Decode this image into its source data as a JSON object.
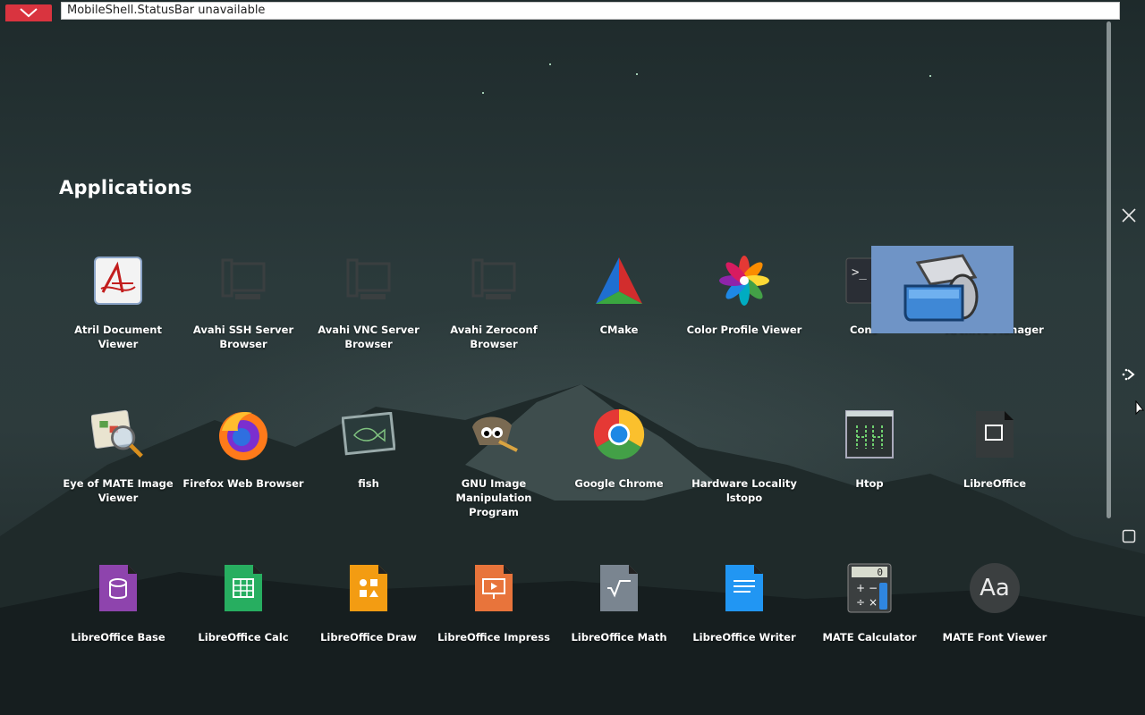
{
  "status_bar": {
    "text": "MobileShell.StatusBar unavailable"
  },
  "section": {
    "title": "Applications"
  },
  "apps": [
    {
      "label": "Atril Document Viewer",
      "icon": "atril-icon"
    },
    {
      "label": "Avahi SSH Server Browser",
      "icon": "avahi-ssh-icon"
    },
    {
      "label": "Avahi VNC Server Browser",
      "icon": "avahi-vnc-icon"
    },
    {
      "label": "Avahi Zeroconf Browser",
      "icon": "avahi-zeroconf-icon"
    },
    {
      "label": "CMake",
      "icon": "cmake-icon"
    },
    {
      "label": "Color Profile Viewer",
      "icon": "color-profile-icon"
    },
    {
      "label": "Cons",
      "icon": "console-icon"
    },
    {
      "label": "Archive Manager",
      "icon": "archive-manager-icon"
    },
    {
      "label": "Eye of MATE Image Viewer",
      "icon": "eye-of-mate-icon"
    },
    {
      "label": "Firefox Web Browser",
      "icon": "firefox-icon"
    },
    {
      "label": "fish",
      "icon": "fish-icon"
    },
    {
      "label": "GNU Image Manipulation Program",
      "icon": "gimp-icon"
    },
    {
      "label": "Google Chrome",
      "icon": "chrome-icon"
    },
    {
      "label": "Hardware Locality lstopo",
      "icon": "lstopo-icon"
    },
    {
      "label": "Htop",
      "icon": "htop-icon"
    },
    {
      "label": "LibreOffice",
      "icon": "libreoffice-icon"
    },
    {
      "label": "LibreOffice Base",
      "icon": "libreoffice-base-icon"
    },
    {
      "label": "LibreOffice Calc",
      "icon": "libreoffice-calc-icon"
    },
    {
      "label": "LibreOffice Draw",
      "icon": "libreoffice-draw-icon"
    },
    {
      "label": "LibreOffice Impress",
      "icon": "libreoffice-impress-icon"
    },
    {
      "label": "LibreOffice Math",
      "icon": "libreoffice-math-icon"
    },
    {
      "label": "LibreOffice Writer",
      "icon": "libreoffice-writer-icon"
    },
    {
      "label": "MATE Calculator",
      "icon": "mate-calculator-icon"
    },
    {
      "label": "MATE Font Viewer",
      "icon": "mate-font-viewer-icon"
    }
  ],
  "calculator_display": "0",
  "font_viewer_glyph": "Aa",
  "terminal_prompt": ">_",
  "colors": {
    "accent_red": "#d9343f",
    "drag_overlay": "#6f94c6"
  }
}
